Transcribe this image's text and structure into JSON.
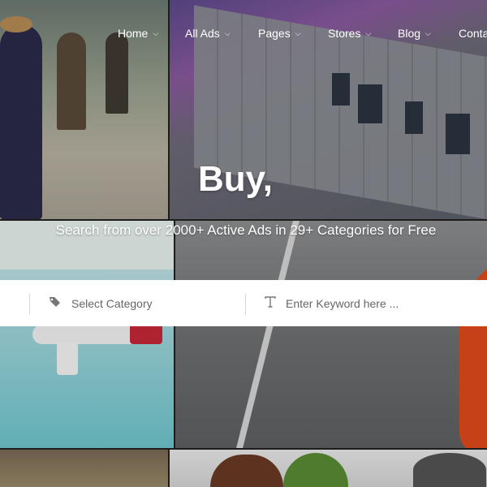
{
  "nav": {
    "items": [
      {
        "label": "Home"
      },
      {
        "label": "All Ads"
      },
      {
        "label": "Pages"
      },
      {
        "label": "Stores"
      },
      {
        "label": "Blog"
      },
      {
        "label": "Conta"
      }
    ]
  },
  "hero": {
    "title": "Buy,",
    "subtitle": "Search from over 2000+ Active Ads in 29+ Categories for Free"
  },
  "search": {
    "category_placeholder": "Select Category",
    "keyword_placeholder": "Enter Keyword here ..."
  },
  "icons": {
    "dropdown": "chevron-down-icon",
    "category": "tags-icon",
    "keyword": "text-icon"
  }
}
